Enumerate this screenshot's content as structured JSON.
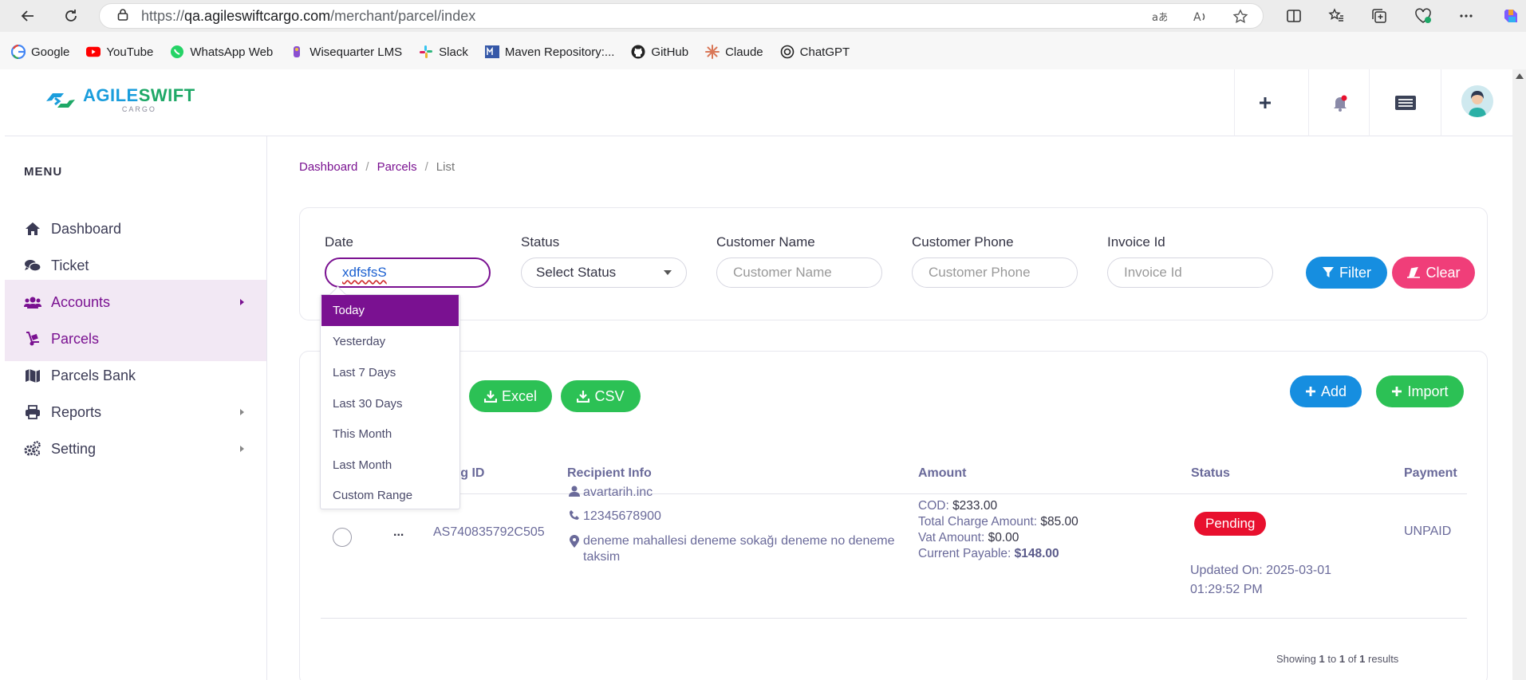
{
  "browser": {
    "url_prefix": "https://",
    "url_domain": "qa.agileswiftcargo.com",
    "url_path": "/merchant/parcel/index",
    "bookmarks": [
      {
        "label": "Google"
      },
      {
        "label": "YouTube"
      },
      {
        "label": "WhatsApp Web"
      },
      {
        "label": "Wisequarter LMS"
      },
      {
        "label": "Slack"
      },
      {
        "label": "Maven Repository:..."
      },
      {
        "label": "GitHub"
      },
      {
        "label": "Claude"
      },
      {
        "label": "ChatGPT"
      }
    ]
  },
  "app": {
    "logo_main_a": "AGILE",
    "logo_main_b": "SWIFT",
    "logo_sub": "CARGO",
    "accent": "#7a1191"
  },
  "sidebar": {
    "title": "MENU",
    "items": [
      {
        "label": "Dashboard"
      },
      {
        "label": "Ticket"
      },
      {
        "label": "Accounts"
      },
      {
        "label": "Parcels"
      },
      {
        "label": "Parcels Bank"
      },
      {
        "label": "Reports"
      },
      {
        "label": "Setting"
      }
    ]
  },
  "breadcrumb": {
    "items": [
      "Dashboard",
      "Parcels",
      "List"
    ],
    "separator": "/"
  },
  "filter": {
    "date_label": "Date",
    "date_value": "xdfsfsS",
    "status_label": "Status",
    "status_value": "Select Status",
    "customer_name_label": "Customer Name",
    "customer_name_placeholder": "Customer Name",
    "customer_phone_label": "Customer Phone",
    "customer_phone_placeholder": "Customer Phone",
    "invoice_label": "Invoice Id",
    "invoice_placeholder": "Invoice Id",
    "filter_button": "Filter",
    "clear_button": "Clear"
  },
  "date_dropdown": {
    "options": [
      "Today",
      "Yesterday",
      "Last 7 Days",
      "Last 30 Days",
      "This Month",
      "Last Month",
      "Custom Range"
    ],
    "selected": "Today"
  },
  "toolbar": {
    "excel": "Excel",
    "csv": "CSV",
    "add": "Add",
    "import": "Import"
  },
  "table": {
    "columns": {
      "tracking": "ing ID",
      "recipient": "Recipient Info",
      "amount": "Amount",
      "status": "Status",
      "payment": "Payment"
    },
    "rows": [
      {
        "actions": "...",
        "tracking_id": "AS740835792C505",
        "recipient_name": "avartarih.inc",
        "recipient_phone": "12345678900",
        "recipient_address_1": "deneme mahallesi deneme sokağı deneme no deneme",
        "recipient_address_2": "taksim",
        "cod_label": "COD:",
        "cod_value": "$233.00",
        "total_label": "Total Charge Amount:",
        "total_value": "$85.00",
        "vat_label": "Vat Amount:",
        "vat_value": "$0.00",
        "payable_label": "Current Payable:",
        "payable_value": "$148.00",
        "status": "Pending",
        "updated_1": "Updated On: 2025-03-01",
        "updated_2": "01:29:52 PM",
        "payment": "UNPAID"
      }
    ],
    "showing_prefix": "Showing",
    "showing_from": "1",
    "showing_to_word": "to",
    "showing_to": "1",
    "showing_of_word": "of",
    "showing_total": "1",
    "showing_suffix": "results"
  }
}
